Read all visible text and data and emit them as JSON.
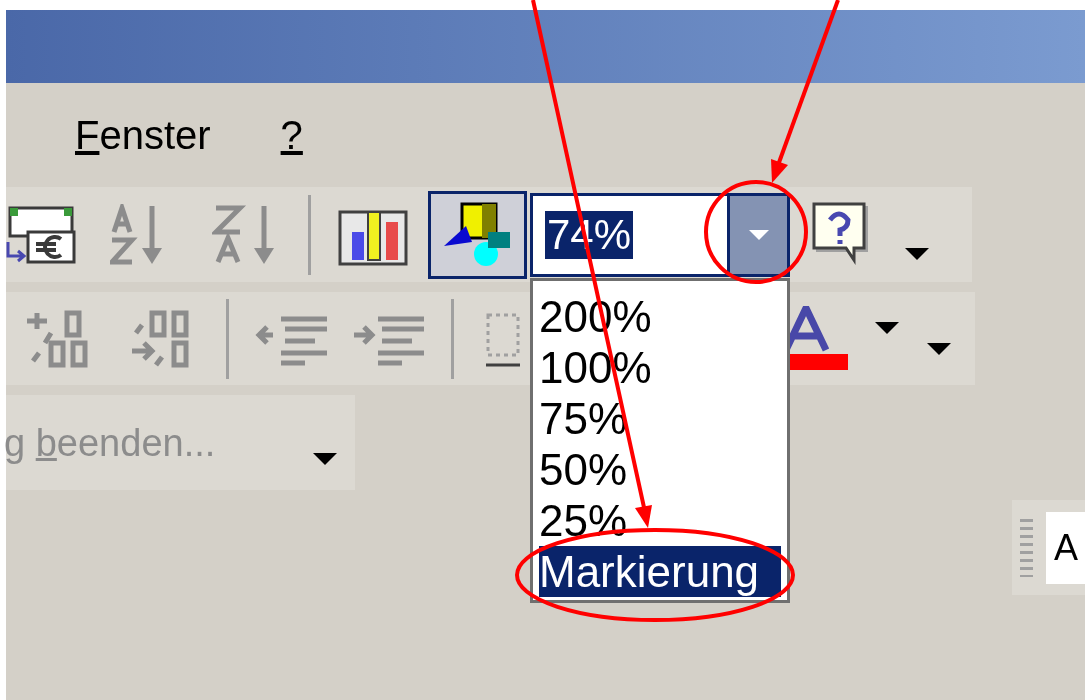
{
  "menu": [
    {
      "accel": "F",
      "rest": "enster"
    },
    {
      "accel": "?"
    }
  ],
  "zoom": {
    "value": "74%",
    "options": [
      {
        "label": "200%",
        "selected": false
      },
      {
        "label": "100%",
        "selected": false
      },
      {
        "label": "75%",
        "selected": false
      },
      {
        "label": "50%",
        "selected": false
      },
      {
        "label": "25%",
        "selected": false
      },
      {
        "label": "Markierung",
        "selected": true
      }
    ]
  },
  "toolbar3": {
    "before": "g ",
    "accel": "b",
    "after": "eenden..."
  },
  "floating_toolbar": {
    "label": "A"
  }
}
